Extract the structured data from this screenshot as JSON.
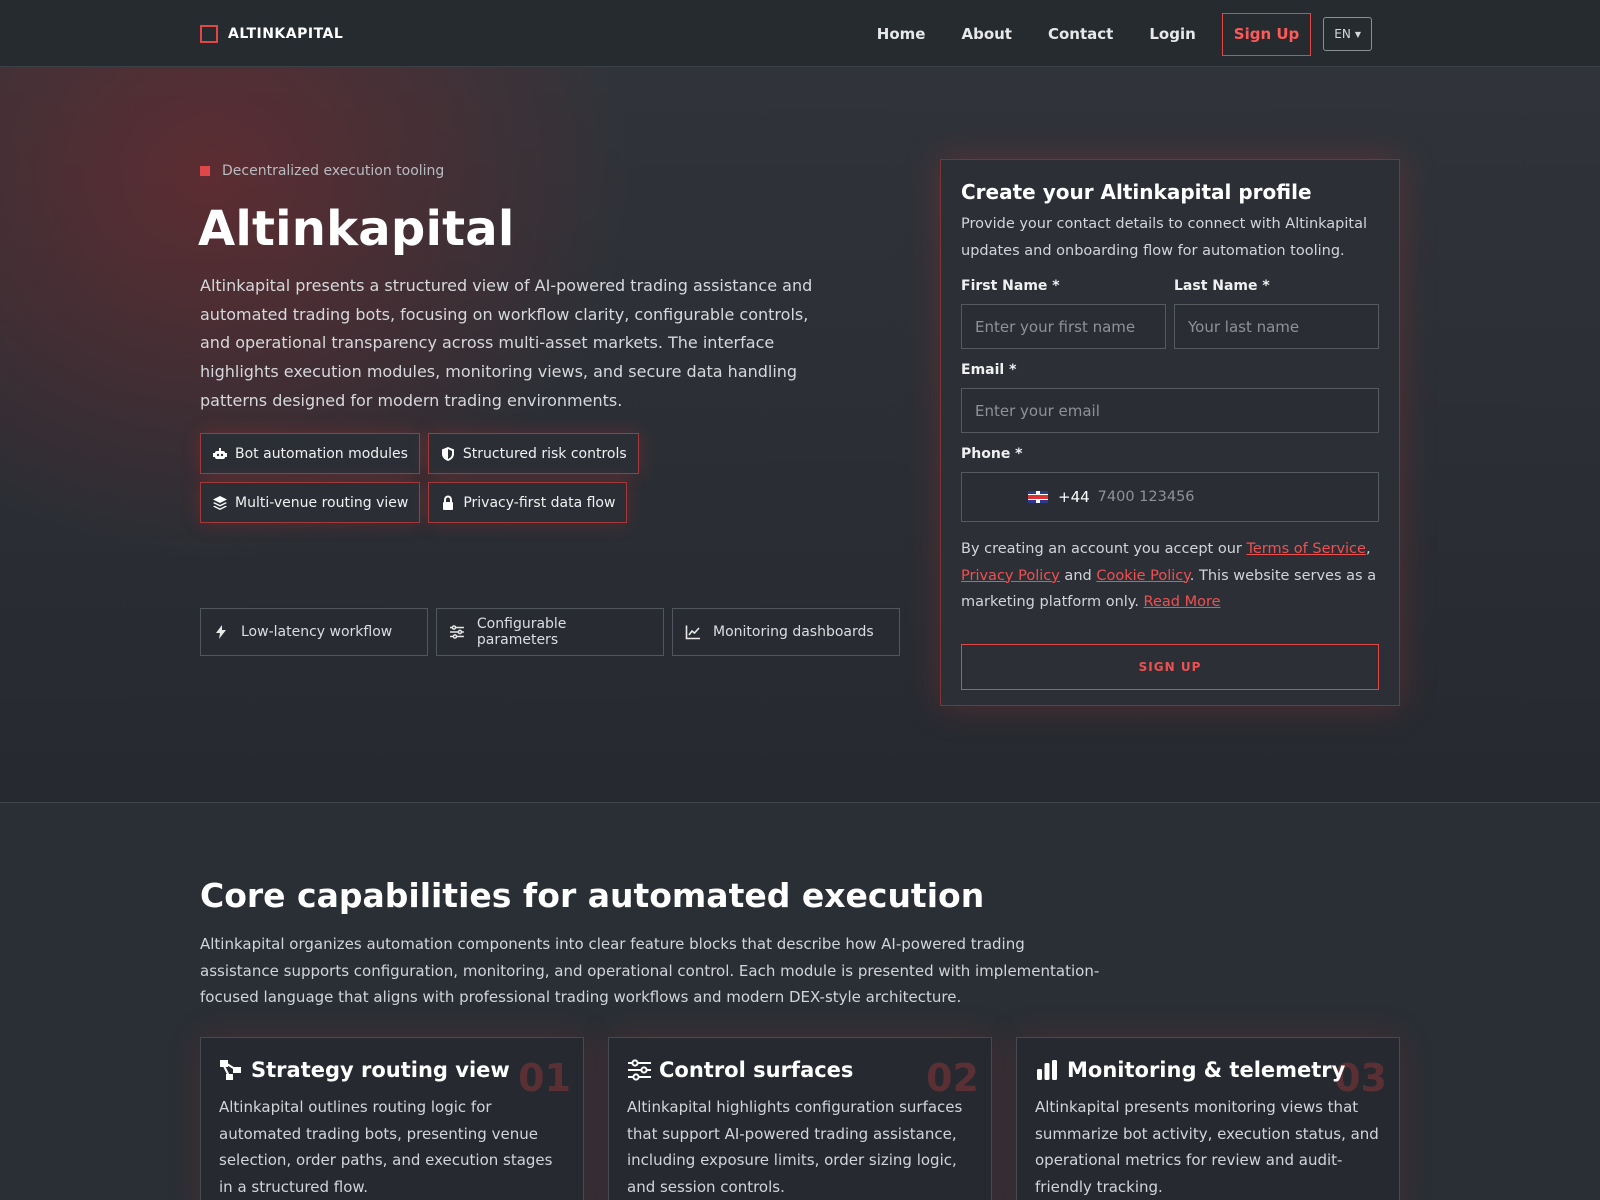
{
  "nav": {
    "brand": "ALTINKAPITAL",
    "links": [
      "Home",
      "About",
      "Contact",
      "Login"
    ],
    "signup": "Sign Up",
    "lang": "EN"
  },
  "hero": {
    "eyebrow": "Decentralized execution tooling",
    "title": "Altinkapital",
    "description": "Altinkapital presents a structured view of AI-powered trading assistance and automated trading bots, focusing on workflow clarity, configurable controls, and operational transparency across multi-asset markets. The interface highlights execution modules, monitoring views, and secure data handling patterns designed for modern trading environments.",
    "chips": [
      {
        "label": "Bot automation modules",
        "icon": "robot-icon"
      },
      {
        "label": "Structured risk controls",
        "icon": "shield-icon"
      },
      {
        "label": "Multi-venue routing view",
        "icon": "layers-icon"
      },
      {
        "label": "Privacy-first data flow",
        "icon": "lock-icon"
      }
    ],
    "features": [
      {
        "label": "Low-latency workflow",
        "icon": "bolt-icon"
      },
      {
        "label": "Configurable parameters",
        "icon": "sliders-icon"
      },
      {
        "label": "Monitoring dashboards",
        "icon": "line-chart-icon"
      }
    ]
  },
  "form": {
    "title": "Create your Altinkapital profile",
    "subtitle": "Provide your contact details to connect with Altinkapital updates and onboarding flow for automation tooling.",
    "first_name_label": "First Name *",
    "first_name_placeholder": "Enter your first name",
    "last_name_label": "Last Name *",
    "last_name_placeholder": "Your last name",
    "email_label": "Email *",
    "email_placeholder": "Enter your email",
    "phone_label": "Phone *",
    "phone_dial": "+44",
    "phone_placeholder": "7400 123456",
    "legal_prefix": "By creating an account you accept our ",
    "terms": "Terms of Service",
    "comma": ",",
    "privacy": "Privacy Policy",
    "and": " and ",
    "cookie": "Cookie Policy",
    "legal_suffix": ". This website serves as a marketing platform only. ",
    "read_more": "Read More",
    "submit": "SIGN UP"
  },
  "capabilities": {
    "title": "Core capabilities for automated execution",
    "description": "Altinkapital organizes automation components into clear feature blocks that describe how AI-powered trading assistance supports configuration, monitoring, and operational control. Each module is presented with implementation-focused language that aligns with professional trading workflows and modern DEX-style architecture.",
    "cards": [
      {
        "num": "01",
        "title": "Strategy routing view",
        "icon": "route-icon",
        "body": "Altinkapital outlines routing logic for automated trading bots, presenting venue selection, order paths, and execution stages in a structured flow."
      },
      {
        "num": "02",
        "title": "Control surfaces",
        "icon": "sliders-icon",
        "body": "Altinkapital highlights configuration surfaces that support AI-powered trading assistance, including exposure limits, order sizing logic, and session controls."
      },
      {
        "num": "03",
        "title": "Monitoring & telemetry",
        "icon": "bar-chart-icon",
        "body": "Altinkapital presents monitoring views that summarize bot activity, execution status, and operational metrics for review and audit-friendly tracking."
      }
    ]
  },
  "colors": {
    "accent": "#e04848",
    "background": "#2a2f35",
    "nav": "#262b30"
  }
}
